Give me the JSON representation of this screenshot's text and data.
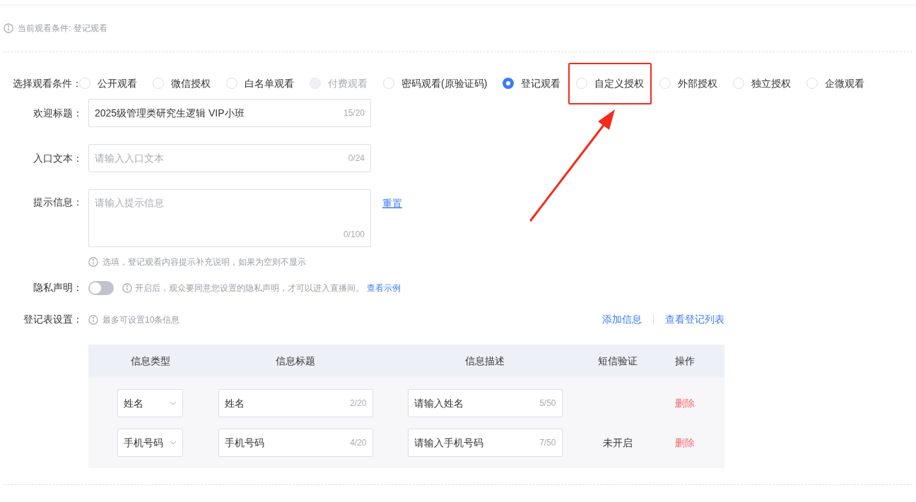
{
  "current_condition": "当前观看条件: 登记观看",
  "watch_condition": {
    "label": "选择观看条件：",
    "options": [
      {
        "label": "公开观看",
        "selected": false,
        "disabled": false,
        "highlighted": false
      },
      {
        "label": "微信授权",
        "selected": false,
        "disabled": false,
        "highlighted": false
      },
      {
        "label": "白名单观看",
        "selected": false,
        "disabled": false,
        "highlighted": false
      },
      {
        "label": "付费观看",
        "selected": false,
        "disabled": true,
        "highlighted": false
      },
      {
        "label": "密码观看(原验证码)",
        "selected": false,
        "disabled": false,
        "highlighted": false
      },
      {
        "label": "登记观看",
        "selected": true,
        "disabled": false,
        "highlighted": false
      },
      {
        "label": "自定义授权",
        "selected": false,
        "disabled": false,
        "highlighted": true
      },
      {
        "label": "外部授权",
        "selected": false,
        "disabled": false,
        "highlighted": false
      },
      {
        "label": "独立授权",
        "selected": false,
        "disabled": false,
        "highlighted": false
      },
      {
        "label": "企微观看",
        "selected": false,
        "disabled": false,
        "highlighted": false
      }
    ]
  },
  "welcome_title": {
    "label": "欢迎标题：",
    "value": "2025级管理类研究生逻辑 VIP小班",
    "count": "15/20"
  },
  "entry_text": {
    "label": "入口文本：",
    "placeholder": "请输入入口文本",
    "count": "0/24"
  },
  "hint_info": {
    "label": "提示信息：",
    "placeholder": "请输入提示信息",
    "count": "0/100",
    "reset": "重置",
    "note": "选填，登记观看内容提示补充说明，如果为空则不显示"
  },
  "privacy": {
    "label": "隐私声明：",
    "on": false,
    "note": "开启后，观众要同意您设置的隐私声明，才可以进入直播间。",
    "link": "查看示例"
  },
  "registration": {
    "label": "登记表设置：",
    "note": "最多可设置10条信息",
    "add": "添加信息",
    "view_list": "查看登记列表",
    "columns": [
      "信息类型",
      "信息标题",
      "信息描述",
      "短信验证",
      "操作"
    ],
    "rows": [
      {
        "type": "姓名",
        "title": "姓名",
        "title_count": "2/20",
        "description": "请输入姓名",
        "description_count": "5/50",
        "action": "删除"
      },
      {
        "type": "手机号码",
        "title": "手机号码",
        "title_count": "4/20",
        "description": "请输入手机号码",
        "description_count": "7/50",
        "sms": "未开启",
        "action": "删除"
      }
    ]
  }
}
